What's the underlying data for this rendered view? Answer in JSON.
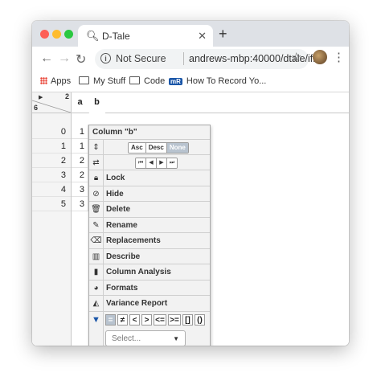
{
  "browser": {
    "tab_title": "D-Tale",
    "tab_close": "✕",
    "new_tab": "+",
    "nav_back": "←",
    "nav_forward": "→",
    "nav_reload": "↻",
    "security": "Not Secure",
    "url": "andrews-mbp:40000/dtale/ifr...",
    "star": "☆",
    "menu": "⋮"
  },
  "bookmarks": {
    "apps": "Apps",
    "items": [
      "My Stuff",
      "Code",
      "How To Record Yo..."
    ],
    "mr_badge": "mR"
  },
  "grid": {
    "corner_cols": "2",
    "corner_rows": "6",
    "columns": [
      "a",
      "b"
    ],
    "rows": [
      {
        "index": "0",
        "a": "1"
      },
      {
        "index": "1",
        "a": "1"
      },
      {
        "index": "2",
        "a": "2"
      },
      {
        "index": "3",
        "a": "2"
      },
      {
        "index": "4",
        "a": "3"
      },
      {
        "index": "5",
        "a": "3"
      }
    ]
  },
  "column_menu": {
    "title": "Column \"b\"",
    "sort": [
      "Asc",
      "Desc",
      "None"
    ],
    "sort_active": "None",
    "move": [
      "⏮",
      "◀",
      "▶",
      "⏭"
    ],
    "items": [
      "Lock",
      "Hide",
      "Delete",
      "Rename",
      "Replacements",
      "Describe",
      "Column Analysis",
      "Formats",
      "Variance Report"
    ],
    "filter_ops": [
      "=",
      "≠",
      "<",
      ">",
      "<=",
      ">=",
      "[]",
      "()"
    ],
    "filter_active": "=",
    "select_placeholder": "Select..."
  }
}
